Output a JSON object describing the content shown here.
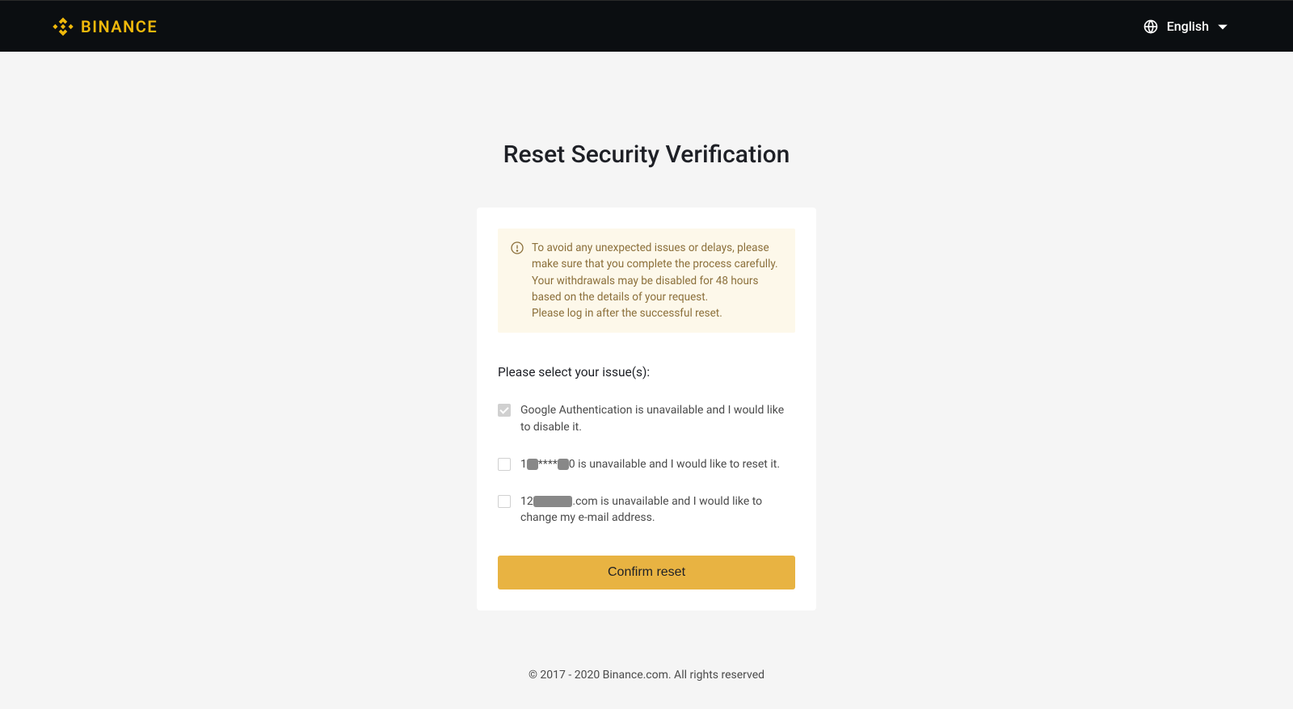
{
  "header": {
    "brand": "BINANCE",
    "language": "English"
  },
  "page": {
    "title": "Reset Security Verification"
  },
  "warning": {
    "line1": "To avoid any unexpected issues or delays, please make sure that you complete the process carefully. Your withdrawals may be disabled for 48 hours based on the details of your request.",
    "line2": "Please log in after the successful reset."
  },
  "prompt": "Please select your issue(s):",
  "issues": [
    {
      "label": "Google Authentication is unavailable and I would like to disable it.",
      "checked": true
    },
    {
      "prefix": "1",
      "redacted1": "xx",
      "mid": "****",
      "redacted2": "xx",
      "suffix": "0 is unavailable and I would like to reset it.",
      "checked": false
    },
    {
      "prefix": "12",
      "redacted1": "xxxxxxx",
      "suffix": ".com is unavailable and I would like to change my e-mail address.",
      "checked": false
    }
  ],
  "button": {
    "confirm": "Confirm reset"
  },
  "footer": {
    "copyright": "© 2017 - 2020 Binance.com. All rights reserved"
  }
}
